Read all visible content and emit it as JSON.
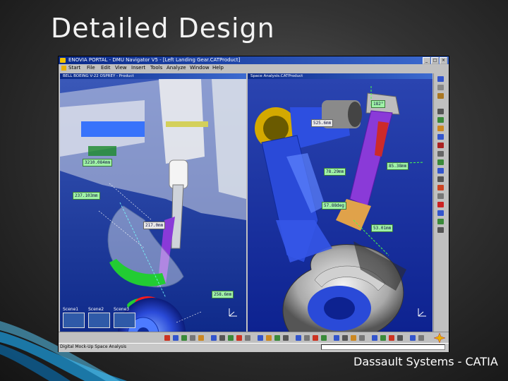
{
  "slide": {
    "title": "Detailed Design",
    "credit": "Dassault Systems - CATIA"
  },
  "window": {
    "title": "ENOVIA PORTAL - DMU Navigator V5 - [Left Landing Gear.CATProduct]",
    "buttons": [
      "_",
      "□",
      "×"
    ]
  },
  "menubar": {
    "items": [
      "Start",
      "File",
      "Edit",
      "View",
      "Insert",
      "Tools",
      "Analyze",
      "Window",
      "Help"
    ]
  },
  "viewports": {
    "left": {
      "header": "BELL BOEING V-22 OSPREY - Product",
      "measurements": [
        "3210.084mm",
        "237.103mm",
        "217.0mm",
        "258.6mm"
      ],
      "scenes": [
        "Scene1",
        "Scene2",
        "Scene3"
      ]
    },
    "right": {
      "header": "Space Analysis.CATProduct",
      "measurements": [
        "182°",
        "525.6mm",
        "78.29mm",
        "85.38mm",
        "57.88deg",
        "53.01mm"
      ]
    }
  },
  "statusbar": {
    "text": "Digital Mock-Up Space Analysis",
    "command_input": ""
  },
  "colors": {
    "titlebar": "#0a2a8a",
    "viewport_bg": "#1d3aa8",
    "measurement": "#9ff2a6",
    "gear_blue": "#2a4ad8",
    "strut_purple": "#8a3ad8"
  }
}
